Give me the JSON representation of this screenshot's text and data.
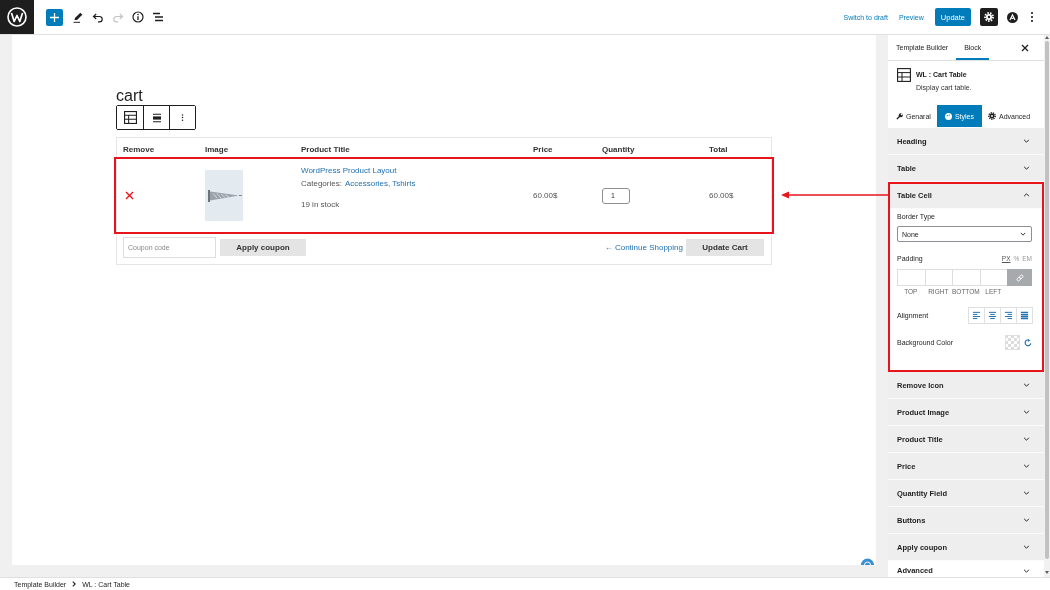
{
  "top_bar": {
    "undo_disabled": false,
    "redo_disabled": true,
    "links": [
      "Switch to draft",
      "Preview"
    ],
    "update_button": "Update"
  },
  "editor": {
    "heading": "cart",
    "table": {
      "columns": [
        "Remove",
        "Image",
        "Product Title",
        "Price",
        "Quantity",
        "Total"
      ],
      "rows": [
        {
          "highlighted": true,
          "title": "WordPress Product Layout",
          "categories_label": "Categories:",
          "categories": "Accessories, Tshirts",
          "stock": "19 in stock",
          "price": "60.00$",
          "quantity": "1",
          "total": "60.00$"
        }
      ],
      "coupon": {
        "placeholder": "Coupon code"
      },
      "apply_button": "Apply coupon",
      "continue_link": "← Continue Shopping",
      "update_button": "Update Cart"
    }
  },
  "sidebar": {
    "tabs": [
      {
        "label": "Template Builder",
        "selected": false
      },
      {
        "label": "Block",
        "selected": true
      }
    ],
    "block": {
      "title": "WL : Cart Table",
      "description": "Display cart table."
    },
    "style_tabs": [
      {
        "label": "Genaral",
        "selected": false
      },
      {
        "label": "Styles",
        "selected": true
      },
      {
        "label": "Advanced",
        "selected": false
      }
    ],
    "panels": [
      {
        "kind": "style",
        "title": "Heading",
        "expanded": false,
        "highlighted": false
      },
      {
        "kind": "style",
        "title": "Table",
        "expanded": false,
        "highlighted": false
      },
      {
        "kind": "style",
        "title": "Table Cell",
        "expanded": true,
        "highlighted": true,
        "settings": {
          "border_type": {
            "label": "Border Type",
            "value": "None"
          },
          "padding": {
            "label": "Padding",
            "units": [
              {
                "label": "PX",
                "selected": true
              },
              {
                "label": "%",
                "selected": false
              },
              {
                "label": "EM",
                "selected": false
              }
            ],
            "sides": [
              "TOP",
              "RIGHT",
              "BOTTOM",
              "LEFT"
            ],
            "linked": true
          },
          "alignment": {
            "label": "Alignment"
          },
          "background_color": {
            "label": "Background Color"
          }
        }
      },
      {
        "kind": "style",
        "title": "Remove Icon",
        "expanded": false,
        "highlighted": false
      },
      {
        "kind": "style",
        "title": "Product Image",
        "expanded": false,
        "highlighted": false
      },
      {
        "kind": "style",
        "title": "Product Title",
        "expanded": false,
        "highlighted": false
      },
      {
        "kind": "style",
        "title": "Price",
        "expanded": false,
        "highlighted": false
      },
      {
        "kind": "style",
        "title": "Quantity Field",
        "expanded": false,
        "highlighted": false
      },
      {
        "kind": "style",
        "title": "Buttons",
        "expanded": false,
        "highlighted": false
      },
      {
        "kind": "style",
        "title": "Apply coupon",
        "expanded": false,
        "highlighted": false
      },
      {
        "kind": "section",
        "title": "Advanced",
        "expanded": false,
        "highlighted": false
      }
    ]
  },
  "breadcrumb": [
    "Template Builder",
    "WL : Cart Table"
  ]
}
